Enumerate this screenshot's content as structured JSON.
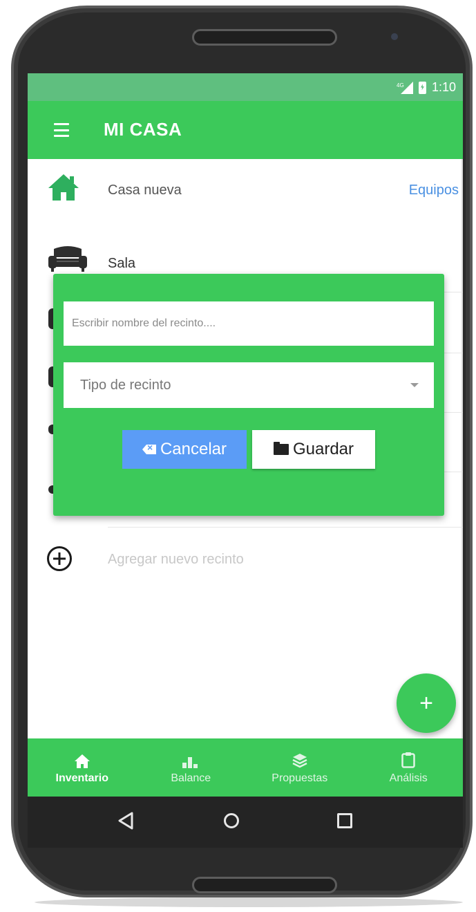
{
  "status_bar": {
    "network": "4G",
    "time": "1:10"
  },
  "app_bar": {
    "title": "MI CASA",
    "menu_icon": "hamburger-icon"
  },
  "house": {
    "name": "Casa nueva",
    "icon": "house-icon",
    "link_label": "Equipos"
  },
  "rooms": [
    {
      "name": "Sala",
      "icon": "sofa-icon"
    }
  ],
  "add_room": {
    "label": "Agregar nuevo recinto",
    "icon": "add-circle-icon"
  },
  "dialog": {
    "name_placeholder": "Escribir nombre del recinto....",
    "name_value": "",
    "type_select": {
      "selected": "Tipo de recinto"
    },
    "cancel_label": "Cancelar",
    "save_label": "Guardar"
  },
  "fab": {
    "label": "+"
  },
  "bottom_nav": {
    "items": [
      {
        "label": "Inventario",
        "icon": "home-icon",
        "active": true
      },
      {
        "label": "Balance",
        "icon": "bar-chart-icon",
        "active": false
      },
      {
        "label": "Propuestas",
        "icon": "layers-icon",
        "active": false
      },
      {
        "label": "Análisis",
        "icon": "clipboard-icon",
        "active": false
      }
    ]
  },
  "colors": {
    "primary": "#3cc95a",
    "status_bar": "#5fbf7f",
    "house_icon": "#2eaf5e",
    "link": "#4a90e2",
    "cancel_button": "#5b9cf6"
  }
}
